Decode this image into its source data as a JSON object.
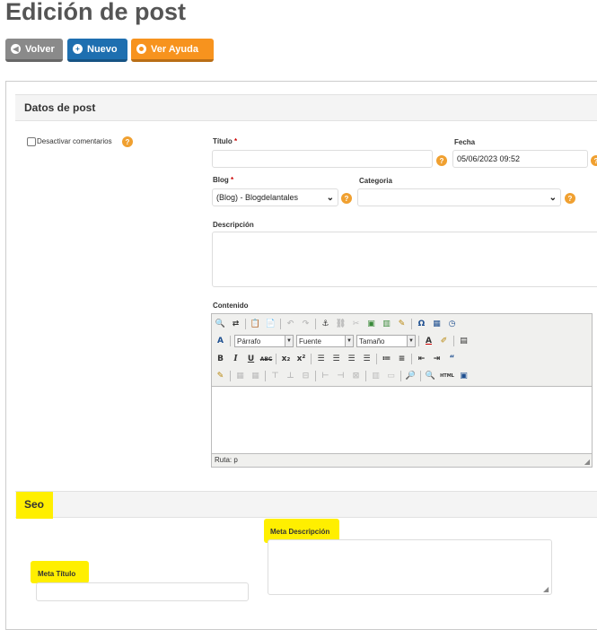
{
  "page_title": "Edición de post",
  "buttons": {
    "back": "Volver",
    "new": "Nuevo",
    "help": "Ver Ayuda"
  },
  "colors": {
    "back_btn": "#8a8a8a",
    "new_btn": "#1e6fb0",
    "help_btn": "#f7931e",
    "help_icon": "#f0a030",
    "highlight": "#ffef00"
  },
  "post_section": {
    "title": "Datos de post",
    "disable_comments_label": "Desactivar comentarios",
    "titulo_label": "Título",
    "titulo_value": "",
    "fecha_label": "Fecha",
    "fecha_value": "05/06/2023 09:52",
    "blog_label": "Blog",
    "blog_value": "(Blog) - Blogdelantales",
    "categoria_label": "Categoria",
    "categoria_value": "",
    "descripcion_label": "Descripción",
    "contenido_label": "Contenido",
    "required_mark": "*"
  },
  "editor": {
    "paragraph_select": "Párrafo",
    "font_select": "Fuente",
    "size_select": "Tamaño",
    "path_label": "Ruta: p"
  },
  "seo_section": {
    "title": "Seo",
    "meta_title_label": "Meta Título",
    "meta_description_label": "Meta Descripción"
  },
  "icons": {
    "help": "?",
    "back": "arrow-left-icon",
    "new": "plus-icon",
    "lifebuoy": "lifebuoy-icon"
  }
}
